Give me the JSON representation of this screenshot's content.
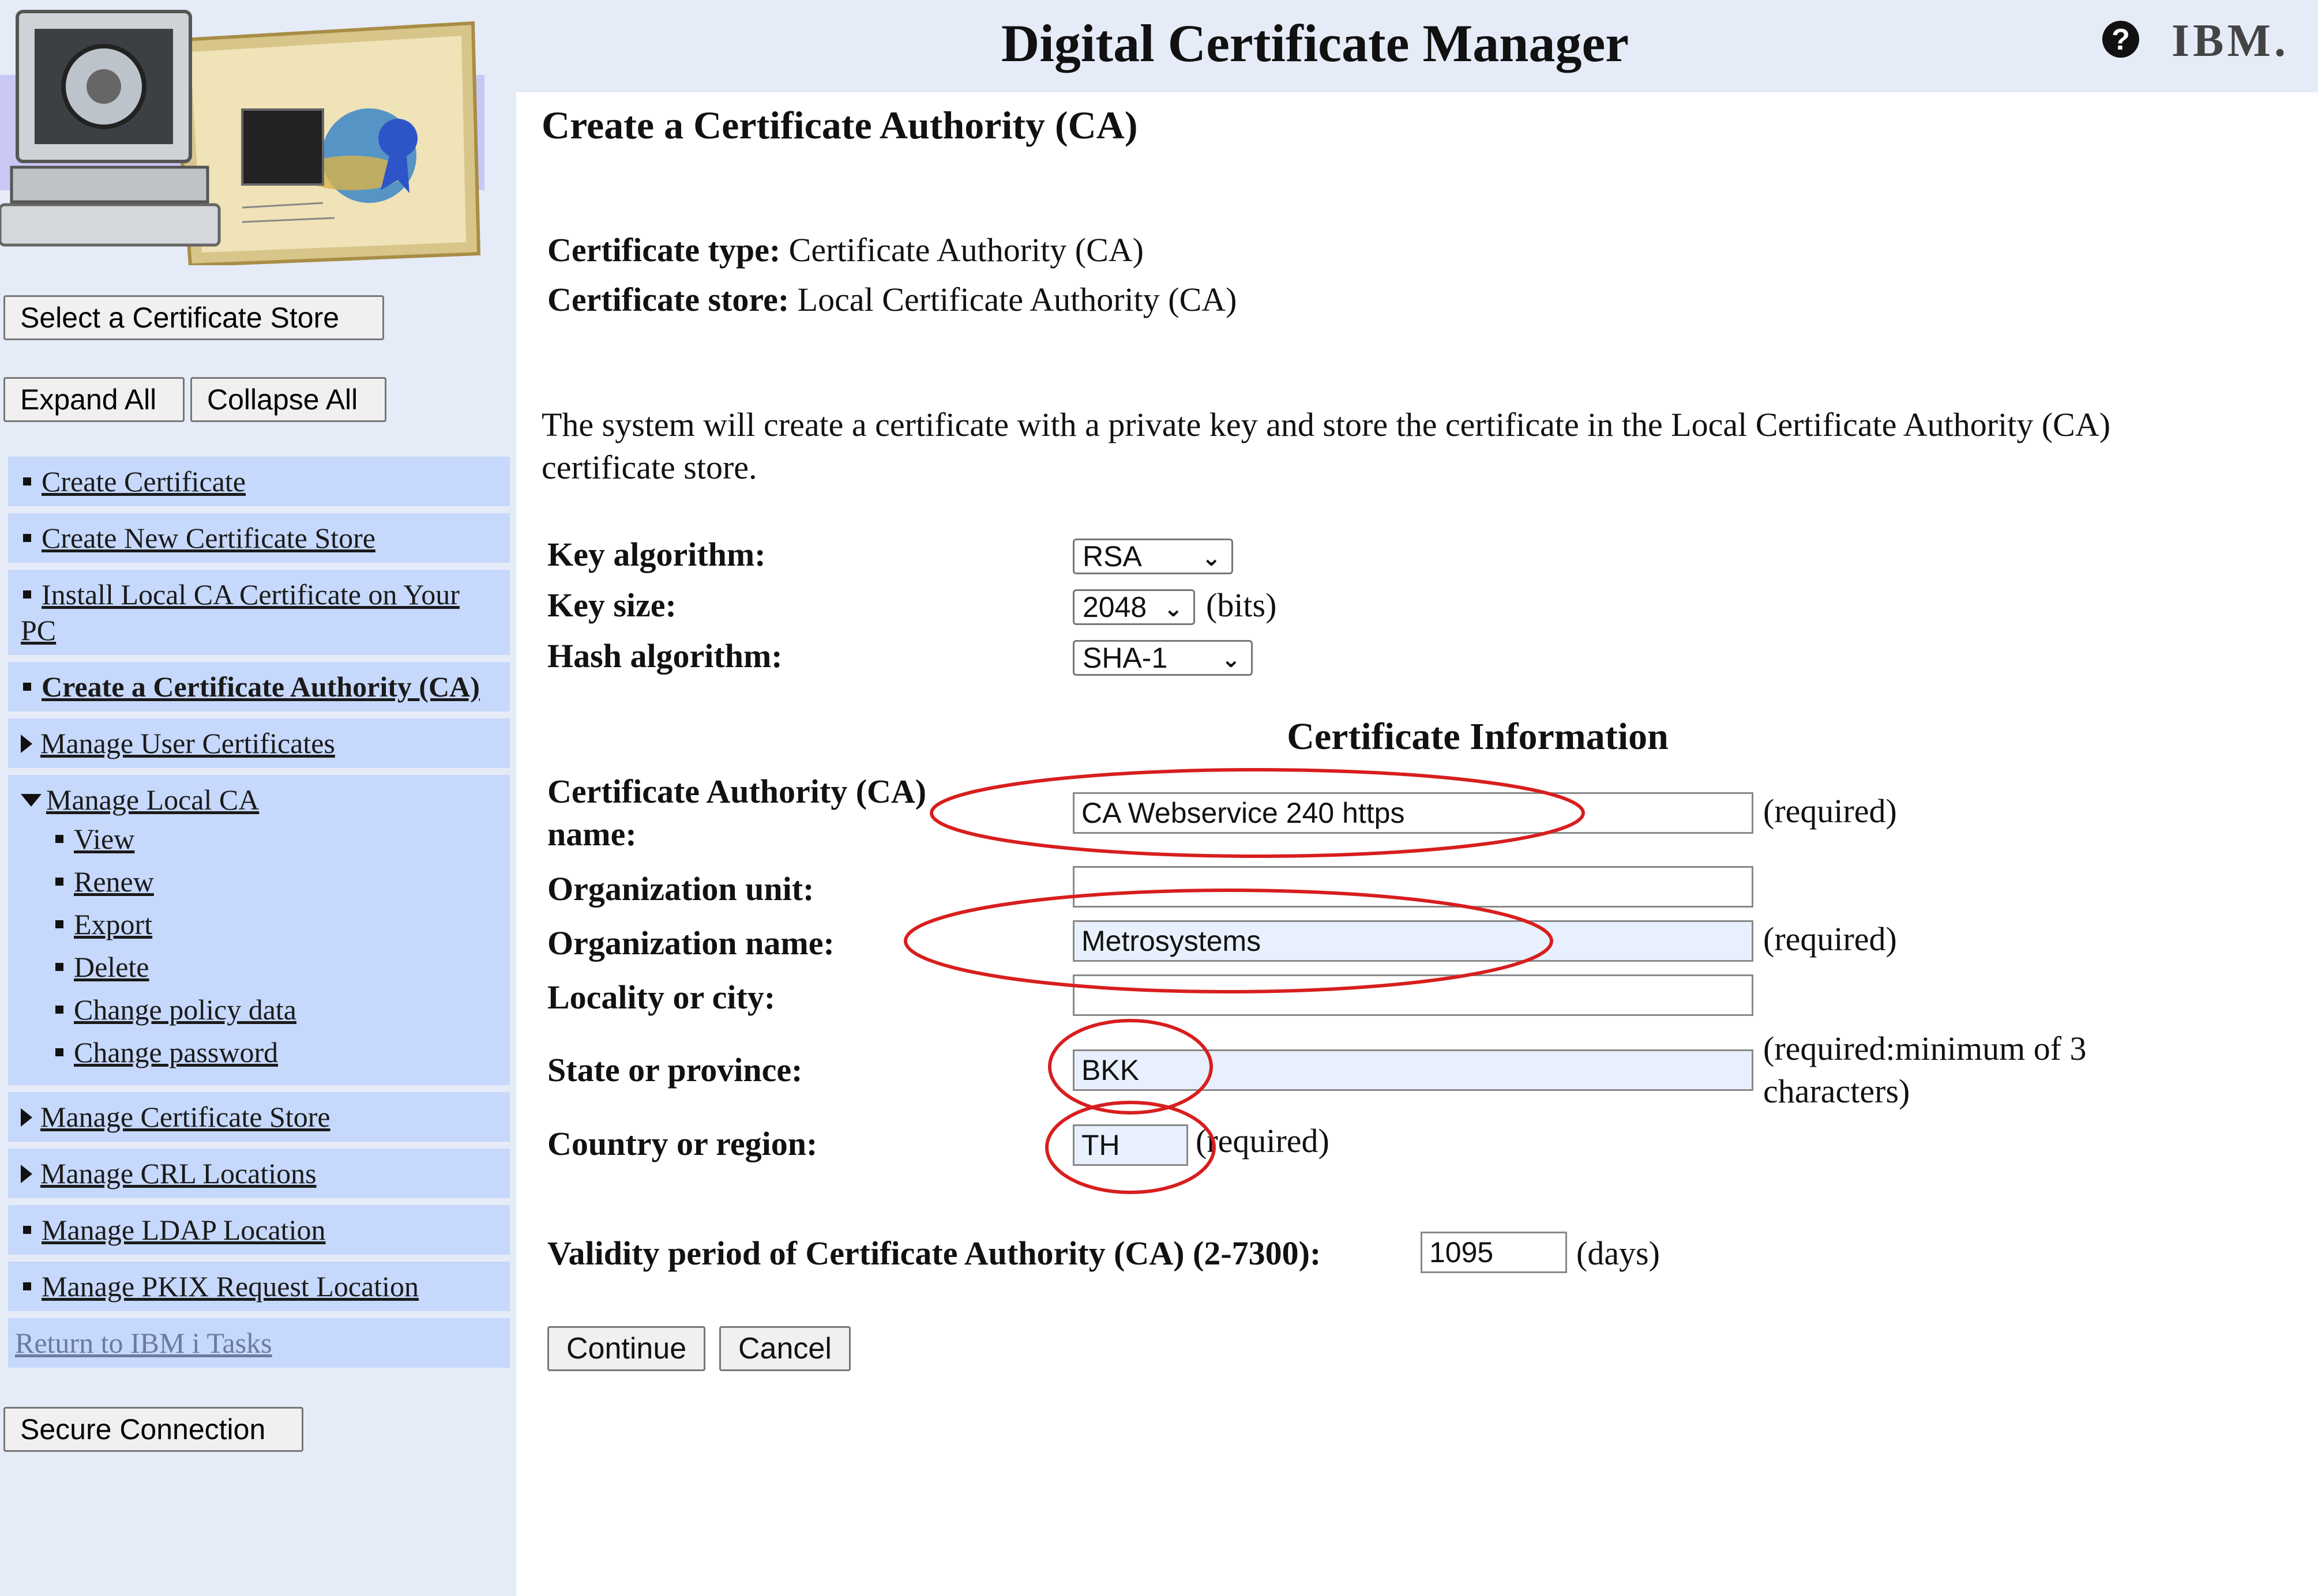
{
  "header": {
    "title": "Digital Certificate Manager",
    "help_symbol": "?",
    "brand": "IBM."
  },
  "sidebar": {
    "select_store_button": "Select a Certificate Store",
    "expand_all_button": "Expand All",
    "collapse_all_button": "Collapse All",
    "items": [
      {
        "label": "Create Certificate",
        "marker": "bullet"
      },
      {
        "label": "Create New Certificate Store",
        "marker": "bullet"
      },
      {
        "label": "Install Local CA Certificate on Your PC",
        "marker": "bullet"
      },
      {
        "label": "Create a Certificate Authority (CA)",
        "marker": "bullet",
        "active": true
      },
      {
        "label": "Manage User Certificates",
        "marker": "collapsed"
      },
      {
        "label": "Manage Local CA",
        "marker": "expanded",
        "children": [
          "View",
          "Renew",
          "Export",
          "Delete",
          "Change policy data",
          "Change password"
        ]
      },
      {
        "label": "Manage Certificate Store",
        "marker": "collapsed"
      },
      {
        "label": "Manage CRL Locations",
        "marker": "collapsed"
      },
      {
        "label": "Manage LDAP Location",
        "marker": "bullet"
      },
      {
        "label": "Manage PKIX Request Location",
        "marker": "bullet"
      }
    ],
    "return_link": "Return to IBM i Tasks",
    "secure_connection_button": "Secure Connection"
  },
  "main": {
    "page_title": "Create a Certificate Authority (CA)",
    "certificate_type_label": "Certificate type:",
    "certificate_type_value": "Certificate Authority (CA)",
    "certificate_store_label": "Certificate store:",
    "certificate_store_value": "Local Certificate Authority (CA)",
    "description": "The system will create a certificate with a private key and store the certificate in the Local Certificate Authority (CA) certificate store.",
    "key_algorithm_label": "Key algorithm:",
    "key_algorithm_value": "RSA",
    "key_size_label": "Key size:",
    "key_size_value": "2048",
    "key_size_unit": "(bits)",
    "hash_algorithm_label": "Hash algorithm:",
    "hash_algorithm_value": "SHA-1",
    "cert_info_heading": "Certificate Information",
    "ca_name_label": "Certificate Authority (CA) name:",
    "ca_name_value": "CA Webservice 240 https",
    "ca_name_note": "(required)",
    "org_unit_label": "Organization unit:",
    "org_unit_value": "",
    "org_name_label": "Organization name:",
    "org_name_value": "Metrosystems",
    "org_name_note": "(required)",
    "locality_label": "Locality or city:",
    "locality_value": "",
    "state_label": "State or province:",
    "state_value": "BKK",
    "state_note": "(required:minimum of 3 characters)",
    "country_label": "Country or region:",
    "country_value": "TH",
    "country_note": "(required)",
    "validity_label": "Validity period of Certificate Authority (CA) (2-7300):",
    "validity_value": "1095",
    "validity_unit": "(days)",
    "continue_button": "Continue",
    "cancel_button": "Cancel"
  },
  "colors": {
    "sidebar_bg": "#e6ebf8",
    "nav_item_bg": "#c6d8fb",
    "annotation_red": "#d81e1e",
    "filled_input_bg": "#e8f0fe"
  }
}
